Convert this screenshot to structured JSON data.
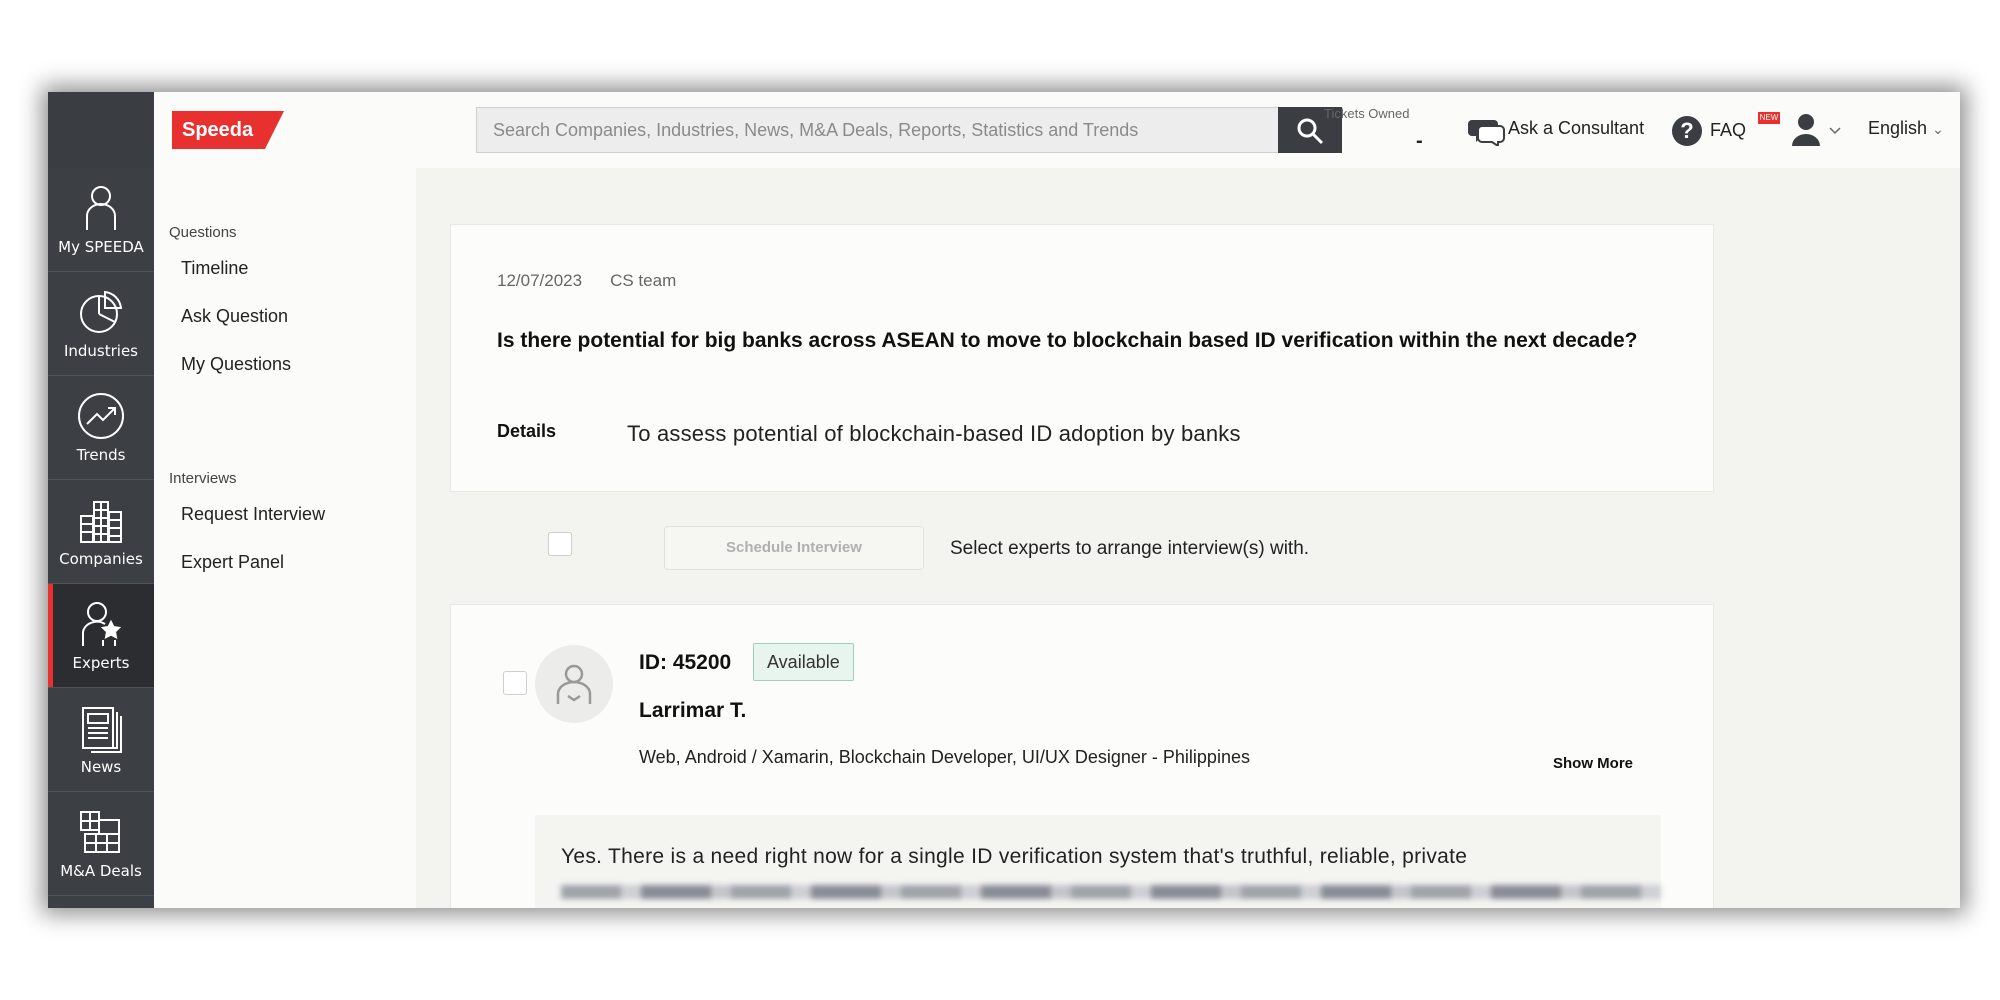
{
  "nav": {
    "items": [
      {
        "label": "My SPEEDA",
        "icon": "person-icon"
      },
      {
        "label": "Industries",
        "icon": "pie-chart-icon"
      },
      {
        "label": "Trends",
        "icon": "trend-arrow-icon"
      },
      {
        "label": "Companies",
        "icon": "buildings-icon"
      },
      {
        "label": "Experts",
        "icon": "expert-star-icon"
      },
      {
        "label": "News",
        "icon": "newspaper-icon"
      },
      {
        "label": "M&A Deals",
        "icon": "grid-blocks-icon"
      }
    ]
  },
  "header": {
    "logo": "Speeda",
    "search_placeholder": "Search Companies, Industries, News, M&A Deals, Reports, Statistics and Trends",
    "tickets_label": "Tickets Owned",
    "tickets_value": "-",
    "ask_consultant": "Ask a Consultant",
    "faq": "FAQ",
    "faq_badge": "NEW",
    "language": "English"
  },
  "sidebar": {
    "section_questions": "Questions",
    "questions_links": [
      "Timeline",
      "Ask Question",
      "My Questions"
    ],
    "section_interviews": "Interviews",
    "interviews_links": [
      "Request Interview",
      "Expert Panel"
    ]
  },
  "question": {
    "date": "12/07/2023",
    "team": "CS team",
    "title": "Is there potential for big banks across ASEAN to move to blockchain based ID verification within the next decade?",
    "details_label": "Details",
    "details": "To assess potential of blockchain-based ID adoption by banks"
  },
  "schedule": {
    "button": "Schedule Interview",
    "hint": "Select experts to arrange interview(s) with."
  },
  "expert": {
    "id": "ID: 45200",
    "status": "Available",
    "name": "Larrimar T.",
    "description": "Web, Android / Xamarin, Blockchain Developer, UI/UX Designer - Philippines",
    "show_more": "Show More",
    "answer": "Yes. There is a need right now for a single ID verification system that's truthful, reliable, private"
  },
  "colors": {
    "brand_red": "#e8312e",
    "nav_dark": "#3c3f44",
    "available_bg": "#e8f5ee"
  }
}
